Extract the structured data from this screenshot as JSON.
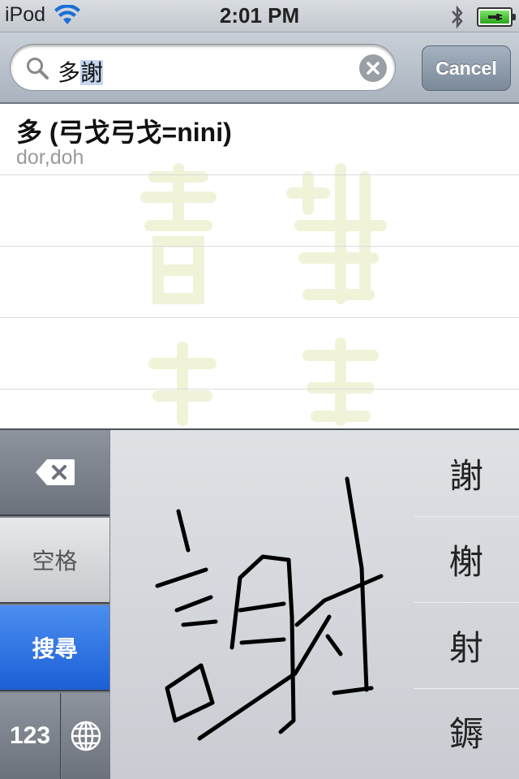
{
  "status_bar": {
    "carrier": "iPod",
    "time": "2:01 PM",
    "icons": [
      "wifi-icon",
      "bluetooth-icon",
      "battery-charging-icon"
    ]
  },
  "search": {
    "prefix": "多",
    "marked": "謝",
    "cancel_label": "Cancel"
  },
  "results": [
    {
      "title": "多 (弓戈弓戈=nini)",
      "subtitle": "dor,doh"
    }
  ],
  "keyboard": {
    "space_label": "空格",
    "search_label": "搜尋",
    "numbers_label": "123",
    "candidates": [
      "謝",
      "榭",
      "射",
      "鎒"
    ]
  },
  "colors": {
    "search_key": "#2a6ee0",
    "watermark": "#f2f4dc"
  }
}
